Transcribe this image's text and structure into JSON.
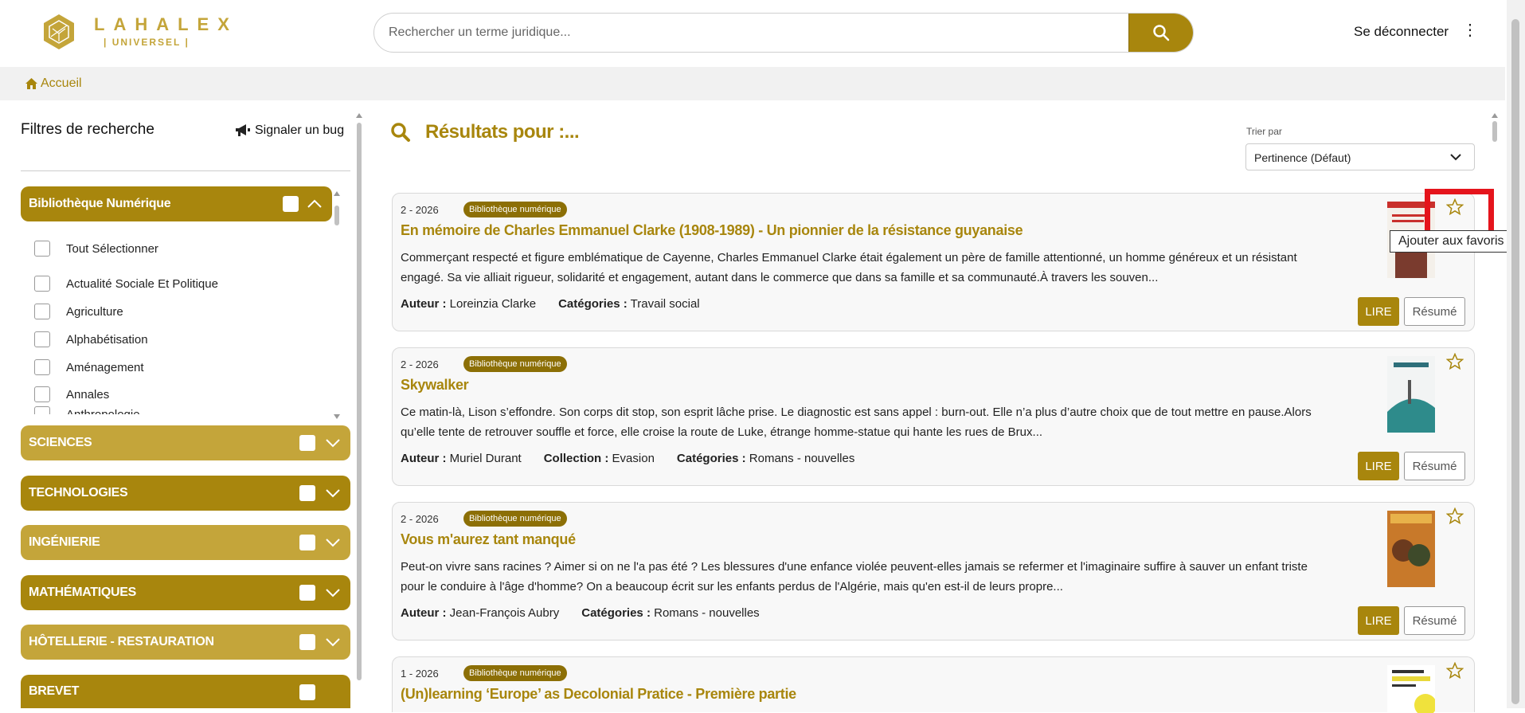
{
  "brand": {
    "line1": "LAHALEX",
    "line2": "| UNIVERSEL |"
  },
  "search": {
    "placeholder": "Rechercher un terme juridique..."
  },
  "header": {
    "logout": "Se déconnecter"
  },
  "breadcrumb": {
    "home": "Accueil"
  },
  "sidebar": {
    "title": "Filtres de recherche",
    "bug": "Signaler un bug",
    "open_category": "Bibliothèque Numérique",
    "items": [
      "Tout Sélectionner",
      "Actualité Sociale Et Politique",
      "Agriculture",
      "Alphabétisation",
      "Aménagement",
      "Annales",
      "Anthropologie"
    ],
    "categories": [
      "SCIENCES",
      "TECHNOLOGIES",
      "INGÉNIERIE",
      "MATHÉMATIQUES",
      "HÔTELLERIE - RESTAURATION",
      "BREVET"
    ]
  },
  "results": {
    "title": "Résultats pour :...",
    "sort_label": "Trier par",
    "sort_value": "Pertinence (Défaut)",
    "lire": "LIRE",
    "resume": "Résumé",
    "tooltip": "Ajouter aux favoris",
    "labels": {
      "author": "Auteur :",
      "categories": "Catégories :",
      "collection": "Collection :"
    },
    "cards": [
      {
        "date": "2 - 2026",
        "badge": "Bibliothèque numérique",
        "title": "En mémoire de Charles Emmanuel Clarke (1908-1989) - Un pionnier de la résistance guyanaise",
        "desc": "Commerçant respecté et figure emblématique de Cayenne, Charles Emmanuel Clarke était également un père de famille attentionné, un homme généreux et un résistant engagé. Sa vie alliait rigueur, solidarité et engagement, autant dans le commerce que dans sa famille et sa communauté.À travers les souven...",
        "author": "Loreinzia Clarke",
        "categories": "Travail social",
        "thumb_color": "#c9302c"
      },
      {
        "date": "2 - 2026",
        "badge": "Bibliothèque numérique",
        "title": "Skywalker",
        "desc": "Ce matin-là, Lison s’effondre. Son corps dit stop, son esprit lâche prise. Le diagnostic est sans appel : burn-out. Elle n’a plus d’autre choix que de tout mettre en pause.Alors qu’elle tente de retrouver souffle et force, elle croise la route de Luke, étrange homme-statue qui hante les rues de Brux...",
        "author": "Muriel Durant",
        "collection": "Evasion",
        "categories": "Romans - nouvelles",
        "thumb_color": "#2e8b8b"
      },
      {
        "date": "2 - 2026",
        "badge": "Bibliothèque numérique",
        "title": "Vous m'aurez tant manqué",
        "desc": "Peut-on vivre sans racines ? Aimer si on ne l'a pas été ? Les blessures d'une enfance violée peuvent-elles jamais se refermer et l'imaginaire suffire à sauver un enfant triste pour le conduire à l'âge d'homme? On a beaucoup écrit sur les enfants perdus de l'Algérie, mais qu'en est-il de leurs propre...",
        "author": "Jean-François Aubry",
        "categories": "Romans - nouvelles",
        "thumb_color": "#c8792a"
      },
      {
        "date": "1 - 2026",
        "badge": "Bibliothèque numérique",
        "title": "(Un)learning ‘Europe’ as Decolonial Pratice - Première partie",
        "thumb_color": "#e8d83a"
      }
    ]
  }
}
